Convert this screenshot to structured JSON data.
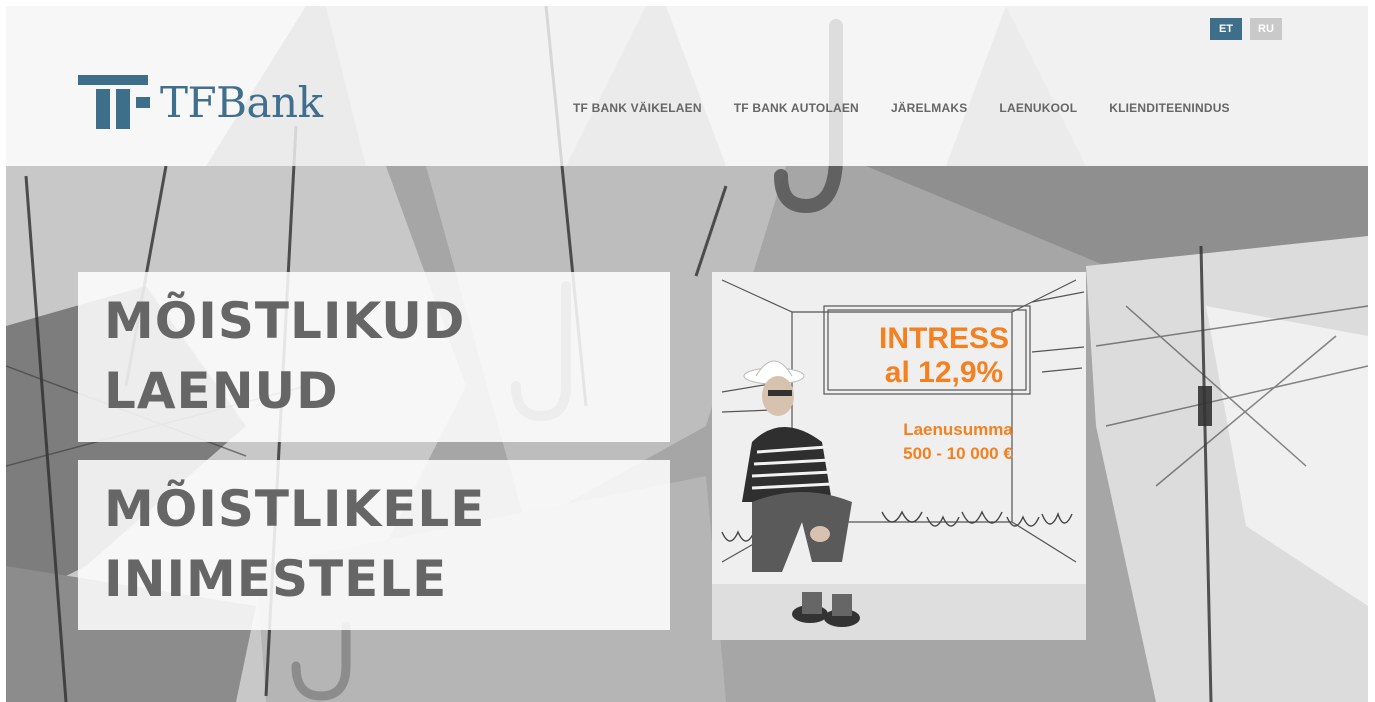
{
  "brand": {
    "name": "TFBank",
    "logo_color": "#3e6f8a"
  },
  "language": {
    "options": [
      {
        "label": "ET",
        "active": true
      },
      {
        "label": "RU",
        "active": false
      }
    ]
  },
  "nav": {
    "items": [
      {
        "label": "TF BANK VÄIKELAEN"
      },
      {
        "label": "TF BANK AUTOLAEN"
      },
      {
        "label": "JÄRELMAKS"
      },
      {
        "label": "LAENUKOOL"
      },
      {
        "label": "KLIENDITEENINDUS"
      }
    ]
  },
  "hero": {
    "headline_1": [
      "MÕISTLIKUD",
      "LAENUD"
    ],
    "headline_2": [
      "MÕISTLIKELE",
      "INIMESTELE"
    ]
  },
  "promo": {
    "rate_line_1": "INTRESS",
    "rate_line_2": "al 12,9%",
    "amount_line_1": "Laenusumma",
    "amount_line_2": "500 - 10 000 €",
    "accent_color": "#f5801f"
  }
}
